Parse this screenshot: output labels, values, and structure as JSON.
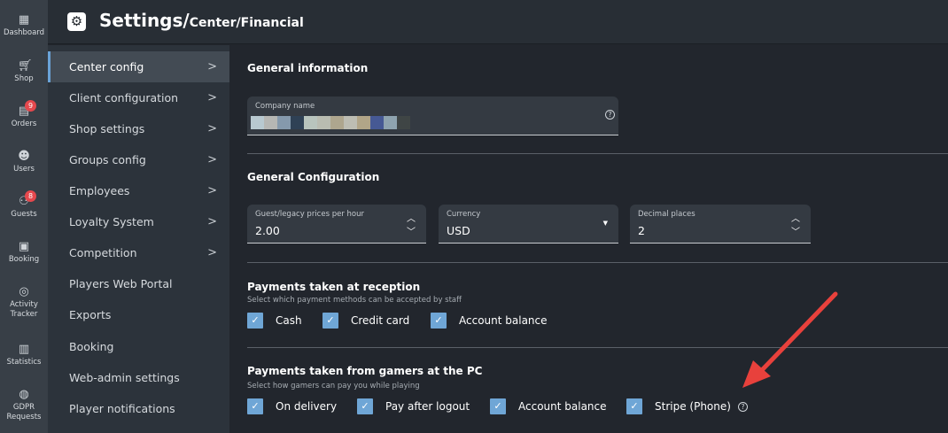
{
  "rail": [
    {
      "label": "Dashboard",
      "icon": "dashboard-icon"
    },
    {
      "label": "Shop",
      "icon": "cart-icon"
    },
    {
      "label": "Orders",
      "icon": "clipboard-icon",
      "badge": "9"
    },
    {
      "label": "Users",
      "icon": "users-icon"
    },
    {
      "label": "Guests",
      "icon": "guests-icon",
      "badge": "8"
    },
    {
      "label": "Booking",
      "icon": "calendar-icon"
    },
    {
      "label": "Activity Tracker",
      "icon": "activity-icon"
    },
    {
      "label": "Statistics",
      "icon": "chart-icon"
    },
    {
      "label": "GDPR Requests",
      "icon": "fingerprint-icon"
    }
  ],
  "header": {
    "title": "Settings/",
    "path": "Center/Financial"
  },
  "submenu": [
    {
      "label": "Center config",
      "chevron": true,
      "active": true
    },
    {
      "label": "Client configuration",
      "chevron": true
    },
    {
      "label": "Shop settings",
      "chevron": true
    },
    {
      "label": "Groups config",
      "chevron": true
    },
    {
      "label": "Employees",
      "chevron": true
    },
    {
      "label": "Loyalty System",
      "chevron": true
    },
    {
      "label": "Competition",
      "chevron": true
    },
    {
      "label": "Players Web Portal"
    },
    {
      "label": "Exports"
    },
    {
      "label": "Booking"
    },
    {
      "label": "Web-admin settings"
    },
    {
      "label": "Player notifications"
    }
  ],
  "general_info": {
    "title": "General information",
    "company_label": "Company name"
  },
  "general_config": {
    "title": "General Configuration",
    "guest_price": {
      "label": "Guest/legacy prices per hour",
      "value": "2.00"
    },
    "currency": {
      "label": "Currency",
      "value": "USD"
    },
    "decimal": {
      "label": "Decimal places",
      "value": "2"
    }
  },
  "reception": {
    "title": "Payments taken at reception",
    "subtitle": "Select which payment methods can be accepted by staff",
    "options": [
      {
        "label": "Cash",
        "checked": true
      },
      {
        "label": "Credit card",
        "checked": true
      },
      {
        "label": "Account balance",
        "checked": true
      }
    ]
  },
  "pc": {
    "title": "Payments taken from gamers at the PC",
    "subtitle": "Select how gamers can pay you while playing",
    "options": [
      {
        "label": "On delivery",
        "checked": true
      },
      {
        "label": "Pay after logout",
        "checked": true
      },
      {
        "label": "Account balance",
        "checked": true
      },
      {
        "label": "Stripe (Phone)",
        "checked": true
      }
    ]
  },
  "colors": {
    "accent": "#6fa6d6",
    "badge": "#e5484d",
    "annotation_arrow": "#e8413c"
  }
}
